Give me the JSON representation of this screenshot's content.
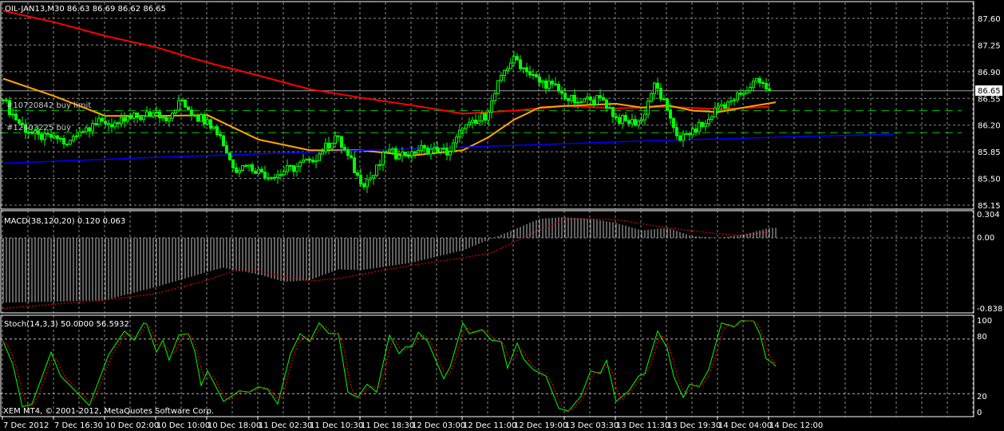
{
  "header": {
    "symbol_label": "OIL-JAN13,M30  86.63 86.69 86.62 86.65",
    "copyright": "XEM MT4, © 2001-2012, MetaQuotes Software Corp."
  },
  "orders": [
    {
      "label": "#10720842 buy limit",
      "price": 86.39
    },
    {
      "label": "#12403225 buy",
      "price": 86.1
    }
  ],
  "current_price": {
    "label": "86.65",
    "value": 86.65
  },
  "colors": {
    "candle": "#00ff00",
    "ma_red": "#ff0000",
    "ma_orange": "#ffa500",
    "ma_blue": "#0000ff",
    "order_line": "#00c000",
    "grid": "#8a8a8a",
    "macd_hist": "#c0c0c0",
    "signal": "#ff0000",
    "stoch_main": "#00ff00"
  },
  "chart_data": [
    {
      "type": "candlestick",
      "title": "OIL-JAN13,M30",
      "ylim": [
        85.15,
        87.6
      ],
      "y_ticks": [
        "87.60",
        "87.25",
        "86.90",
        "86.55",
        "86.20",
        "85.85",
        "85.50",
        "85.15"
      ],
      "y_tick_values": [
        87.6,
        87.25,
        86.9,
        86.55,
        86.2,
        85.85,
        85.5,
        85.15
      ],
      "x_ticks": [
        "7 Dec 2012",
        "7 Dec 16:30",
        "10 Dec 02:00",
        "10 Dec 10:00",
        "10 Dec 18:00",
        "11 Dec 02:30",
        "11 Dec 10:30",
        "11 Dec 18:30",
        "12 Dec 03:00",
        "12 Dec 11:00",
        "12 Dec 19:00",
        "13 Dec 03:30",
        "13 Dec 11:30",
        "13 Dec 19:30",
        "14 Dec 04:00",
        "14 Dec 12:00"
      ],
      "bars_per_close_sample": 4,
      "closes": [
        86.53,
        86.27,
        86.11,
        86.01,
        86.06,
        85.95,
        86.11,
        86.22,
        86.22,
        86.22,
        86.29,
        86.32,
        86.37,
        86.29,
        86.53,
        86.32,
        86.27,
        86.06,
        85.64,
        85.66,
        85.62,
        85.51,
        85.59,
        85.66,
        85.74,
        85.85,
        86.06,
        85.8,
        85.43,
        85.54,
        85.85,
        85.8,
        85.85,
        85.9,
        85.85,
        85.85,
        86.16,
        86.22,
        86.37,
        86.85,
        87.1,
        86.9,
        86.76,
        86.74,
        86.55,
        86.5,
        86.53,
        86.53,
        86.3,
        86.22,
        86.27,
        86.75,
        86.4,
        86.0,
        86.15,
        86.22,
        86.45,
        86.52,
        86.62,
        86.81,
        86.65
      ],
      "moving_averages": [
        {
          "name": "MA red",
          "points": [
            [
              0,
              87.7
            ],
            [
              16,
              87.55
            ],
            [
              32,
              87.37
            ],
            [
              48,
              87.22
            ],
            [
              64,
              87.02
            ],
            [
              80,
              86.85
            ],
            [
              96,
              86.67
            ],
            [
              112,
              86.56
            ],
            [
              128,
              86.46
            ],
            [
              144,
              86.35
            ],
            [
              160,
              86.39
            ],
            [
              176,
              86.45
            ],
            [
              192,
              86.42
            ],
            [
              208,
              86.44
            ],
            [
              224,
              86.41
            ],
            [
              240,
              86.44
            ]
          ]
        },
        {
          "name": "MA orange",
          "points": [
            [
              0,
              86.81
            ],
            [
              16,
              86.58
            ],
            [
              32,
              86.32
            ],
            [
              48,
              86.32
            ],
            [
              64,
              86.33
            ],
            [
              80,
              86.01
            ],
            [
              96,
              85.87
            ],
            [
              112,
              85.87
            ],
            [
              128,
              85.8
            ],
            [
              144,
              85.87
            ],
            [
              152,
              86.04
            ],
            [
              160,
              86.27
            ],
            [
              168,
              86.43
            ],
            [
              176,
              86.45
            ],
            [
              192,
              86.48
            ],
            [
              200,
              86.43
            ],
            [
              208,
              86.46
            ],
            [
              216,
              86.39
            ],
            [
              224,
              86.37
            ],
            [
              232,
              86.43
            ],
            [
              242,
              86.5
            ]
          ]
        },
        {
          "name": "MA blue",
          "points": [
            [
              0,
              85.7
            ],
            [
              50,
              85.78
            ],
            [
              100,
              85.85
            ],
            [
              150,
              85.92
            ],
            [
              200,
              85.99
            ],
            [
              250,
              86.05
            ],
            [
              279,
              86.08
            ]
          ]
        }
      ]
    },
    {
      "type": "histogram",
      "title": "MACD(38,120,20) 0.120 0.063",
      "label": "MACD(38,120,20) 0.120 0.063",
      "y_ticks": [
        "0.304",
        "0.00",
        "-0.838"
      ],
      "ylim": [
        -0.838,
        0.304
      ],
      "macd": [
        [
          0,
          -0.78
        ],
        [
          16,
          -0.77
        ],
        [
          32,
          -0.75
        ],
        [
          48,
          -0.59
        ],
        [
          64,
          -0.41
        ],
        [
          69,
          -0.36
        ],
        [
          80,
          -0.44
        ],
        [
          88,
          -0.53
        ],
        [
          96,
          -0.51
        ],
        [
          105,
          -0.38
        ],
        [
          112,
          -0.39
        ],
        [
          128,
          -0.3
        ],
        [
          144,
          -0.15
        ],
        [
          153,
          -0.01
        ],
        [
          160,
          0.1
        ],
        [
          168,
          0.23
        ],
        [
          175,
          0.25
        ],
        [
          184,
          0.23
        ],
        [
          192,
          0.18
        ],
        [
          200,
          0.09
        ],
        [
          208,
          0.12
        ],
        [
          216,
          0.02
        ],
        [
          224,
          0.0
        ],
        [
          232,
          0.04
        ],
        [
          240,
          0.12
        ]
      ],
      "signal": [
        [
          0,
          -0.85
        ],
        [
          16,
          -0.8
        ],
        [
          32,
          -0.75
        ],
        [
          48,
          -0.67
        ],
        [
          64,
          -0.51
        ],
        [
          72,
          -0.4
        ],
        [
          80,
          -0.4
        ],
        [
          96,
          -0.52
        ],
        [
          105,
          -0.49
        ],
        [
          112,
          -0.44
        ],
        [
          128,
          -0.33
        ],
        [
          144,
          -0.24
        ],
        [
          153,
          -0.18
        ],
        [
          160,
          -0.05
        ],
        [
          168,
          0.1
        ],
        [
          177,
          0.23
        ],
        [
          192,
          0.22
        ],
        [
          208,
          0.12
        ],
        [
          224,
          0.05
        ],
        [
          232,
          0.03
        ],
        [
          240,
          0.07
        ]
      ]
    },
    {
      "type": "line",
      "title": "Stoch(14,3,3) 50.0000 56.5932",
      "label": "Stoch(14,3,3) 50.0000 56.5932",
      "y_ticks": [
        "100",
        "80",
        "20",
        "0"
      ],
      "ylim": [
        0,
        100
      ],
      "levels": [
        80,
        20
      ],
      "main": [
        [
          0,
          77.2
        ],
        [
          3,
          52.3
        ],
        [
          6,
          5.6
        ],
        [
          9,
          8.5
        ],
        [
          15,
          65.5
        ],
        [
          18,
          39.2
        ],
        [
          21,
          28.9
        ],
        [
          27,
          7.0
        ],
        [
          33,
          62.6
        ],
        [
          38,
          88.9
        ],
        [
          41,
          78.7
        ],
        [
          44,
          97.7
        ],
        [
          45,
          96.2
        ],
        [
          48,
          65.5
        ],
        [
          50,
          78.7
        ],
        [
          52,
          56.7
        ],
        [
          55,
          84.5
        ],
        [
          58,
          86.0
        ],
        [
          60,
          67.0
        ],
        [
          62,
          28.9
        ],
        [
          64,
          45.0
        ],
        [
          66,
          31.9
        ],
        [
          69,
          11.4
        ],
        [
          74,
          23.1
        ],
        [
          77,
          21.6
        ],
        [
          80,
          27.5
        ],
        [
          83,
          24.6
        ],
        [
          86,
          8.5
        ],
        [
          90,
          64.0
        ],
        [
          93,
          86.0
        ],
        [
          96,
          77.2
        ],
        [
          99,
          97.7
        ],
        [
          102,
          86.0
        ],
        [
          105,
          86.0
        ],
        [
          108,
          21.6
        ],
        [
          111,
          15.8
        ],
        [
          114,
          30.4
        ],
        [
          117,
          21.6
        ],
        [
          121,
          84.5
        ],
        [
          124,
          64.0
        ],
        [
          126,
          71.4
        ],
        [
          128,
          71.4
        ],
        [
          130,
          87.4
        ],
        [
          133,
          77.2
        ],
        [
          138,
          36.3
        ],
        [
          140,
          49.4
        ],
        [
          144,
          97.7
        ],
        [
          146,
          86.0
        ],
        [
          150,
          90.4
        ],
        [
          153,
          78.7
        ],
        [
          156,
          77.2
        ],
        [
          158,
          47.9
        ],
        [
          161,
          75.7
        ],
        [
          163,
          58.2
        ],
        [
          166,
          46.5
        ],
        [
          170,
          39.2
        ],
        [
          174,
          4.1
        ],
        [
          177,
          0.5
        ],
        [
          181,
          17.3
        ],
        [
          184,
          45.0
        ],
        [
          187,
          42.1
        ],
        [
          189,
          56.7
        ],
        [
          192,
          11.4
        ],
        [
          196,
          23.1
        ],
        [
          199,
          39.2
        ],
        [
          201,
          42.1
        ],
        [
          205,
          88.9
        ],
        [
          208,
          69.9
        ],
        [
          210,
          39.2
        ],
        [
          213,
          15.8
        ],
        [
          215,
          30.4
        ],
        [
          218,
          27.5
        ],
        [
          221,
          46.5
        ],
        [
          225,
          97.7
        ],
        [
          229,
          93.3
        ],
        [
          231,
          100
        ],
        [
          235,
          100
        ],
        [
          237,
          86.0
        ],
        [
          239,
          58.2
        ],
        [
          241,
          53.9
        ],
        [
          242,
          50.0
        ]
      ]
    }
  ]
}
